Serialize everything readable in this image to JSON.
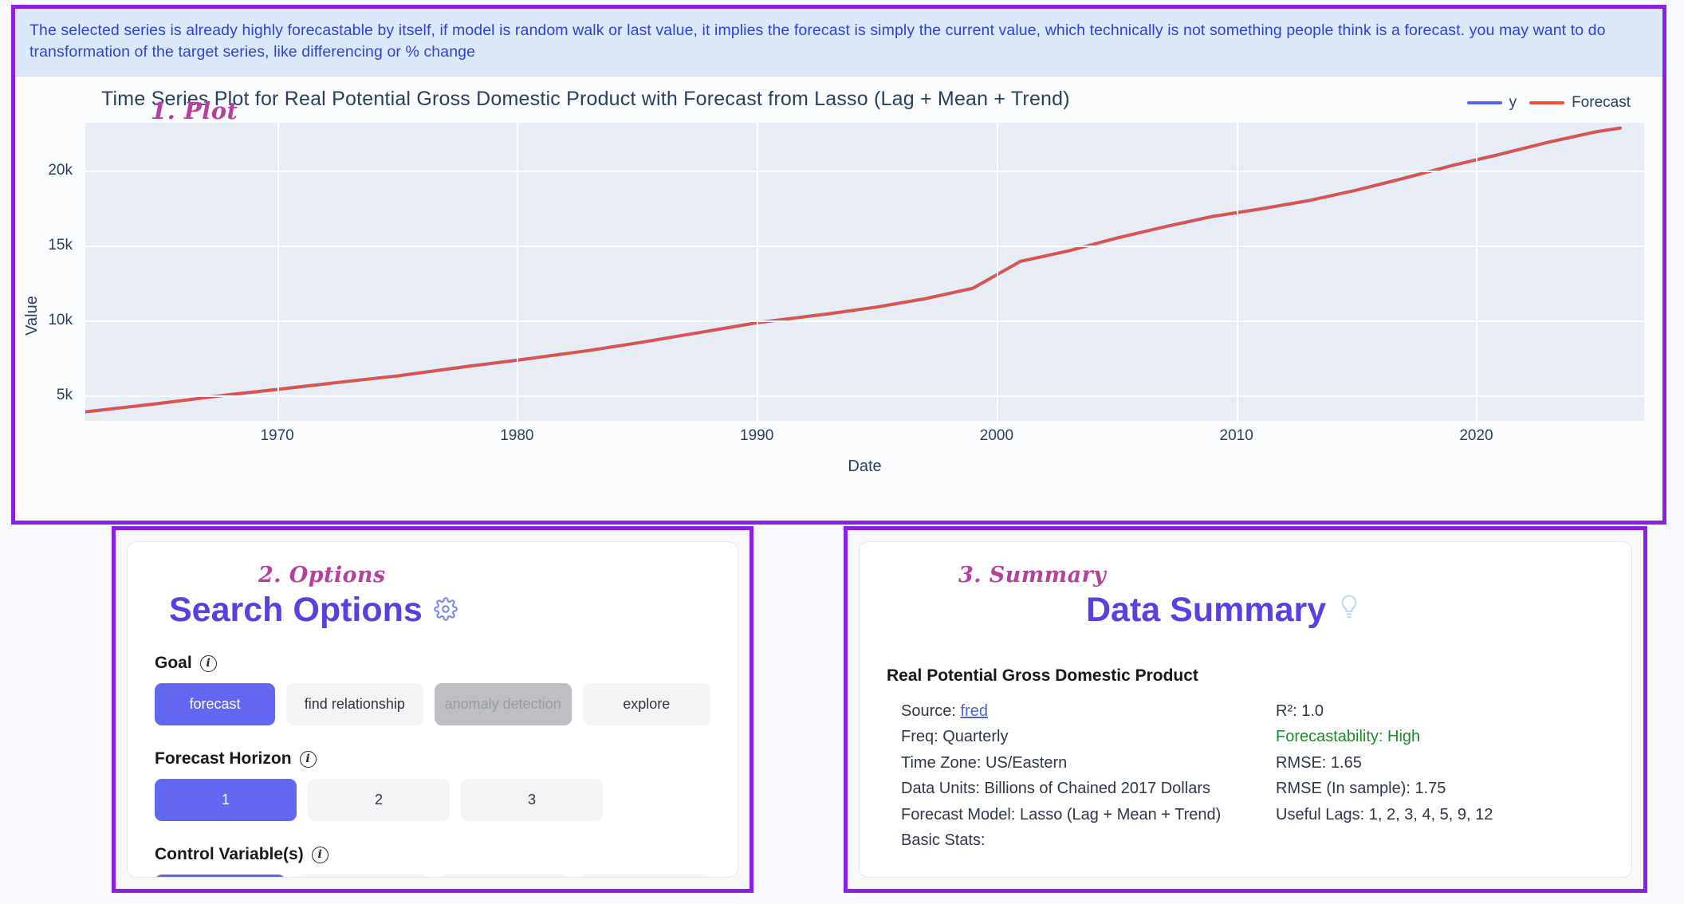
{
  "banner": {
    "text": "The selected series is already highly forecastable by itself, if model is random walk or last value, it implies the forecast is simply the current value, which technically is not something people think is a forecast. you may want to do transformation of the target series, like differencing or % change"
  },
  "plot": {
    "badge": "1. Plot",
    "title": "Time Series Plot for Real Potential Gross Domestic Product with Forecast from Lasso (Lag + Mean + Trend)",
    "legend": [
      {
        "label": "y",
        "color": "#5566ee"
      },
      {
        "label": "Forecast",
        "color": "#e9513a"
      }
    ]
  },
  "chart_data": {
    "type": "line",
    "title": "Time Series Plot for Real Potential Gross Domestic Product with Forecast from Lasso (Lag + Mean + Trend)",
    "xlabel": "Date",
    "ylabel": "Value",
    "xlim": [
      1962,
      2027
    ],
    "ylim": [
      3300,
      23200
    ],
    "xticks": [
      "1970",
      "1980",
      "1990",
      "2000",
      "2010",
      "2020"
    ],
    "xtick_values": [
      1970,
      1980,
      1990,
      2000,
      2010,
      2020
    ],
    "yticks": [
      "5k",
      "10k",
      "15k",
      "20k"
    ],
    "ytick_values": [
      5000,
      10000,
      15000,
      20000
    ],
    "grid": true,
    "legend_position": "top-right",
    "x": [
      1962,
      1965,
      1968,
      1970,
      1973,
      1975,
      1978,
      1980,
      1983,
      1985,
      1988,
      1990,
      1993,
      1995,
      1997,
      1999,
      2001,
      2003,
      2005,
      2007,
      2009,
      2011,
      2013,
      2015,
      2017,
      2019,
      2021,
      2023,
      2025,
      2026
    ],
    "series": [
      {
        "name": "y",
        "color": "#5566ee",
        "values": [
          3900,
          4450,
          5050,
          5400,
          5950,
          6300,
          6950,
          7350,
          8000,
          8500,
          9300,
          9850,
          10450,
          10900,
          11450,
          12150,
          13950,
          14650,
          15500,
          16250,
          16950,
          17450,
          18000,
          18700,
          19500,
          20350,
          21100,
          21900,
          22600,
          22850
        ]
      },
      {
        "name": "Forecast",
        "color": "#e9513a",
        "values": [
          3900,
          4450,
          5050,
          5400,
          5950,
          6300,
          6950,
          7350,
          8000,
          8500,
          9300,
          9850,
          10450,
          10900,
          11450,
          12150,
          13950,
          14650,
          15500,
          16250,
          16950,
          17450,
          18000,
          18700,
          19500,
          20350,
          21100,
          21900,
          22600,
          22850
        ]
      }
    ]
  },
  "options": {
    "script_label": "2. Options",
    "title": "Search Options",
    "gear_icon": "gear-icon",
    "fields": [
      {
        "label": "Goal",
        "info_icon": "info-icon",
        "buttons": [
          {
            "label": "forecast",
            "state": "selected"
          },
          {
            "label": "find relationship",
            "state": "normal"
          },
          {
            "label": "anomaly detection",
            "state": "disabled"
          },
          {
            "label": "explore",
            "state": "normal"
          }
        ]
      },
      {
        "label": "Forecast Horizon",
        "info_icon": "info-icon",
        "buttons": [
          {
            "label": "1",
            "state": "selected"
          },
          {
            "label": "2",
            "state": "normal"
          },
          {
            "label": "3",
            "state": "normal"
          }
        ]
      },
      {
        "label": "Control Variable(s)",
        "info_icon": "info-icon",
        "buttons": [
          {
            "label": "",
            "state": "selected"
          },
          {
            "label": "",
            "state": "normal"
          },
          {
            "label": "",
            "state": "normal"
          },
          {
            "label": "",
            "state": "normal"
          }
        ]
      }
    ]
  },
  "summary": {
    "script_label": "3. Summary",
    "title": "Data Summary",
    "bulb_icon": "lightbulb-icon",
    "series_name": "Real Potential Gross Domestic Product",
    "left_rows": [
      {
        "prefix": "Source: ",
        "link": "fred"
      },
      {
        "prefix": "Freq: Quarterly"
      },
      {
        "prefix": "Time Zone: US/Eastern"
      },
      {
        "prefix": "Data Units: Billions of Chained 2017 Dollars"
      },
      {
        "prefix": "Forecast Model: Lasso (Lag + Mean + Trend)"
      },
      {
        "prefix": "Basic Stats:"
      }
    ],
    "right_rows": [
      {
        "text": "R²: 1.0"
      },
      {
        "text": "Forecastability: High",
        "emphasis": "good"
      },
      {
        "text": "RMSE: 1.65"
      },
      {
        "text": "RMSE (In sample): 1.75"
      },
      {
        "text": "Useful Lags: 1, 2, 3, 4, 5, 9, 12"
      }
    ]
  },
  "colors": {
    "accent_purple": "#8b20e0",
    "title_blue": "#5b3fe0",
    "script_magenta": "#b4419e",
    "selected_blue": "#6366f1",
    "banner_bg": "#dce9fb",
    "banner_text": "#3041d8",
    "plot_bg": "#e8edf5",
    "good_green": "#1a8c28"
  }
}
